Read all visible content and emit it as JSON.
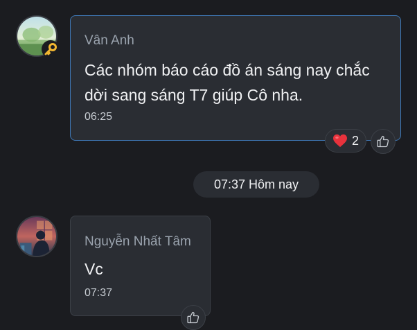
{
  "messages": [
    {
      "sender": "Vân Anh",
      "text_lines": [
        "Các nhóm báo cáo đồ án sáng nay chắc",
        "dời sang sáng T7 giúp Cô nha."
      ],
      "time": "06:25",
      "reaction": {
        "emoji": "heart",
        "count": "2"
      }
    },
    {
      "sender": "Nguyễn Nhất Tâm",
      "text": "Vc",
      "time": "07:37"
    }
  ],
  "divider": {
    "label": "07:37 Hôm nay"
  },
  "colors": {
    "background": "#1b1c20",
    "bubble": "#2a2d33",
    "highlight_border": "#3f78b6",
    "heart": "#e8323c",
    "key": "#f2b731"
  },
  "icons": [
    "key-icon",
    "heart-icon",
    "thumbs-up-icon"
  ]
}
